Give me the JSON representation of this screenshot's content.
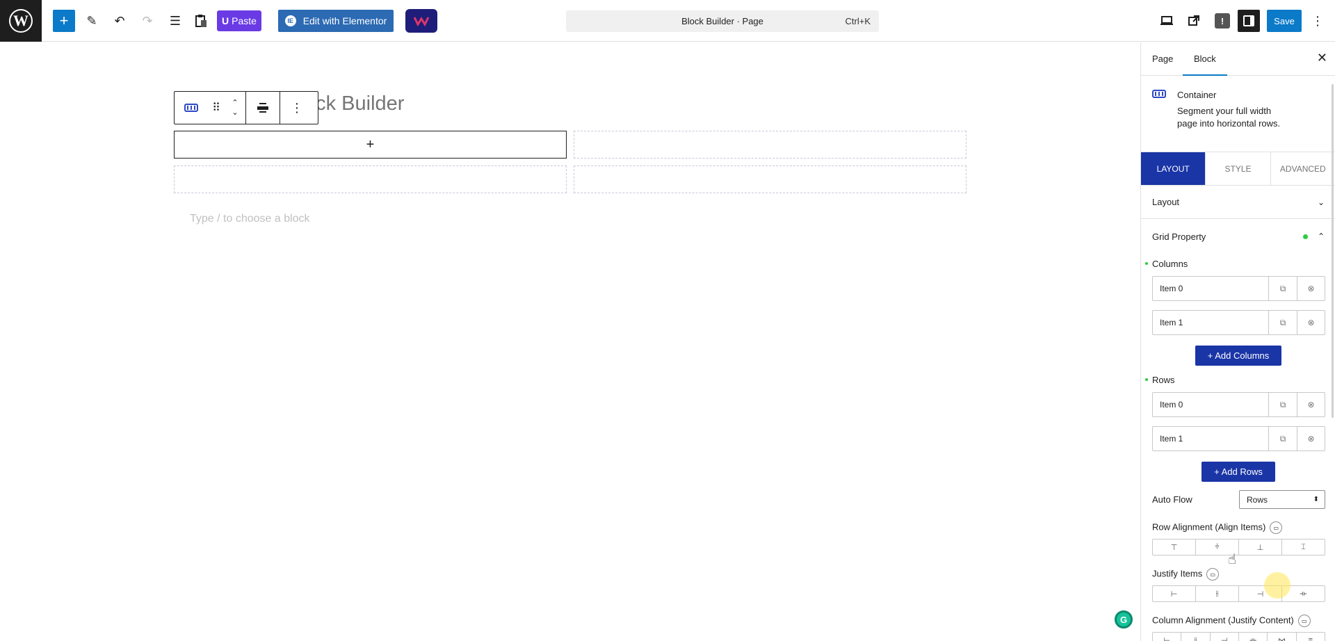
{
  "toolbar": {
    "add_icon": "+",
    "pen_icon": "✎",
    "undo_icon": "↶",
    "redo_icon": "↷",
    "list_icon": "☰",
    "paste_label": "Paste",
    "elementor_label": "Edit with Elementor",
    "elementor_badge": "IE",
    "command_title": "Block Builder · Page",
    "command_shortcut": "Ctrl+K",
    "save_label": "Save"
  },
  "canvas": {
    "page_title": "ock Builder",
    "cell_plus": "+",
    "appender_placeholder": "Type / to choose a block"
  },
  "sidebar": {
    "tabs": [
      "Page",
      "Block"
    ],
    "active_tab": "Block",
    "block_name": "Container",
    "block_description": "Segment your full width page into horizontal rows.",
    "settings_tabs": [
      "LAYOUT",
      "STYLE",
      "ADVANCED"
    ],
    "panels": {
      "layout": "Layout",
      "grid_property": "Grid Property"
    },
    "columns": {
      "label": "Columns",
      "items": [
        "Item 0",
        "Item 1"
      ],
      "add_label": "+ Add Columns"
    },
    "rows": {
      "label": "Rows",
      "items": [
        "Item 0",
        "Item 1"
      ],
      "add_label": "+ Add Rows"
    },
    "auto_flow": {
      "label": "Auto Flow",
      "value": "Rows"
    },
    "row_alignment_label": "Row Alignment (Align Items)",
    "justify_items_label": "Justify Items",
    "column_alignment_label": "Column Alignment (Justify Content)"
  },
  "colors": {
    "accent": "#0b7ac9",
    "brand_blue": "#1a35a6",
    "status_dot": "#2ecc40"
  }
}
